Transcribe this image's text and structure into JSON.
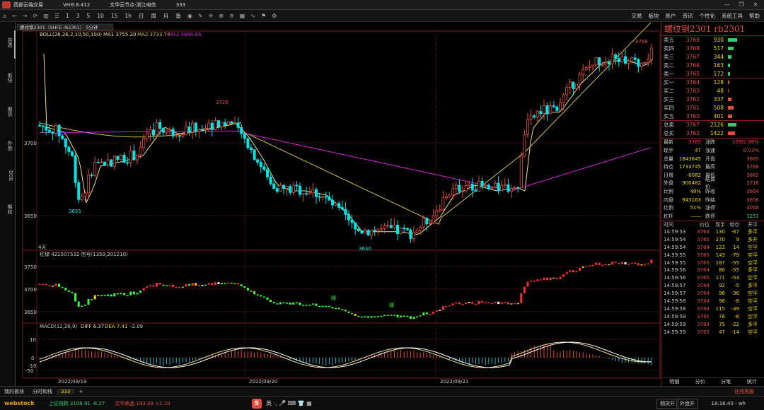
{
  "titlebar": {
    "app_name": "西部云端交易",
    "version": "Ver6.8.412",
    "news": "文华云节点-浙江电信",
    "port": "333",
    "buttons": [
      "—",
      "❐",
      "✕"
    ]
  },
  "toolbar": {
    "periods": [
      "1",
      "3",
      "5",
      "10",
      "15",
      "1h",
      "日",
      "周",
      "月",
      "备"
    ],
    "right_menu": [
      "交易",
      "板块",
      "账户",
      "资讯",
      "个性化",
      "系统工具",
      "帮助"
    ]
  },
  "left_tabs": [
    "自选",
    "板块",
    "期货",
    "外盘",
    "DDE",
    "期权"
  ],
  "chart": {
    "symbol_tag": "螺纹钢2301（SHFE rb2301） 5分钟",
    "boll_label": "BOLL(26,26,2,10,50,100)",
    "ma1": "MA1 3755.20",
    "ma2": "MA2 3733.74",
    "ma3": "MA3 3696.66",
    "main_yaxis": [
      "3700",
      "3650"
    ],
    "annotations": {
      "high_right": "3768",
      "left_high": "3726",
      "left_low": "3655",
      "mid_low": "3630"
    },
    "sub_label": "4天",
    "signal_label": "红绿 421507532 信号(1359,201210)",
    "signal_yaxis": [
      "3750",
      "3700",
      "3650"
    ],
    "signal_marks": [
      "绿",
      "绿"
    ],
    "macd_label": "MACD(12,26,9)",
    "diff": "DIFF 6.37",
    "dea": "DEA 7.41",
    "macd_val": "-2.09",
    "macd_yaxis": [
      "10",
      "0",
      "-10",
      "-50"
    ],
    "dates": [
      "2022/09/19",
      "2022/09/20",
      "2022/09/21"
    ]
  },
  "quote": {
    "name": "螺纹钢2301 rb2301",
    "asks": [
      {
        "label": "卖五",
        "price": "3769",
        "vol": "930",
        "bar": 0.95
      },
      {
        "label": "卖四",
        "price": "3768",
        "vol": "517",
        "bar": 0.55
      },
      {
        "label": "卖三",
        "price": "3767",
        "vol": "344",
        "bar": 0.38
      },
      {
        "label": "卖二",
        "price": "3766",
        "vol": "163",
        "bar": 0.2
      },
      {
        "label": "卖一",
        "price": "3765",
        "vol": "172",
        "bar": 0.2
      }
    ],
    "bids": [
      {
        "label": "买一",
        "price": "3764",
        "vol": "128",
        "bar": 0.15
      },
      {
        "label": "买二",
        "price": "3763",
        "vol": "48",
        "bar": 0.06
      },
      {
        "label": "买三",
        "price": "3762",
        "vol": "337",
        "bar": 0.38
      },
      {
        "label": "买四",
        "price": "3761",
        "vol": "508",
        "bar": 0.55
      },
      {
        "label": "买五",
        "price": "3760",
        "vol": "401",
        "bar": 0.45
      }
    ],
    "total_sell": {
      "label": "总卖",
      "price": "3767",
      "vol": "2126"
    },
    "total_buy": {
      "label": "总买",
      "price": "3762",
      "vol": "1422"
    },
    "stats": [
      {
        "k": "最新",
        "v": "3765",
        "k2": "涨跌",
        "v2": "109/2.98%"
      },
      {
        "k": "现手",
        "v": "47",
        "k2": "涨速",
        "v2": "0.03%"
      },
      {
        "k": "总量",
        "v": "1843645",
        "k2": "开盘",
        "v2": "3665"
      },
      {
        "k": "持仓",
        "v": "1733745",
        "k2": "最高",
        "v2": "3768"
      },
      {
        "k": "日增",
        "v": "-6082",
        "k2": "最低",
        "v2": "3662"
      },
      {
        "k": "外盘",
        "v": "900482",
        "k2": "结算价",
        "v2": "3718"
      },
      {
        "k": "比例",
        "v": "49%",
        "k2": "昨收",
        "v2": "3664"
      },
      {
        "k": "内盘",
        "v": "943163",
        "k2": "昨结",
        "v2": "3656"
      },
      {
        "k": "比例",
        "v": "51%",
        "k2": "涨停",
        "v2": "4058"
      },
      {
        "k": "杠杆",
        "v": "——",
        "k2": "跌停",
        "v2": "3251"
      }
    ],
    "tick_headers": [
      "时间",
      "价位",
      "现手",
      "增仓",
      "开平"
    ],
    "ticks": [
      {
        "t": "14:59:53",
        "p": "3764",
        "v": "130",
        "c": "-67",
        "n": "多平"
      },
      {
        "t": "14:59:54",
        "p": "3765",
        "v": "270",
        "c": "9",
        "n": "多开"
      },
      {
        "t": "14:59:54",
        "p": "3764",
        "v": "123",
        "c": "14",
        "n": "空平"
      },
      {
        "t": "14:59:55",
        "p": "3765",
        "v": "143",
        "c": "-79",
        "n": "空平"
      },
      {
        "t": "14:59:55",
        "p": "3765",
        "v": "187",
        "c": "-55",
        "n": "空平"
      },
      {
        "t": "14:59:56",
        "p": "3764",
        "v": "80",
        "c": "-55",
        "n": "多平"
      },
      {
        "t": "14:59:56",
        "p": "3765",
        "v": "171",
        "c": "-53",
        "n": "空平"
      },
      {
        "t": "14:59:57",
        "p": "3764",
        "v": "92",
        "c": "-5",
        "n": "多平"
      },
      {
        "t": "14:59:57",
        "p": "3764",
        "v": "96",
        "c": "-36",
        "n": "空平"
      },
      {
        "t": "14:59:58",
        "p": "3764",
        "v": "98",
        "c": "-8",
        "n": "空平"
      },
      {
        "t": "14:59:58",
        "p": "3764",
        "v": "115",
        "c": "-49",
        "n": "空平"
      },
      {
        "t": "14:59:59",
        "p": "3765",
        "v": "76",
        "c": "-6",
        "n": "空平"
      },
      {
        "t": "14:59:59",
        "p": "3764",
        "v": "75",
        "c": "-22",
        "n": "多平"
      },
      {
        "t": "14:59:59",
        "p": "3765",
        "v": "47",
        "c": "-14",
        "n": "空平"
      }
    ],
    "bottom_tabs": [
      "明细",
      "分价",
      "分笔",
      "统计"
    ]
  },
  "bottom_tabs": {
    "tabs": [
      "我的板块",
      "分时和线",
      "333",
      "+"
    ],
    "live": "在线客服"
  },
  "status": {
    "brand": "webstock",
    "index1": "上证指数 3108.91 -8.27",
    "index2": "文华商品 193.39 +2.10",
    "ime_s": "S",
    "ime": "英 ·, 🎤 ⌨ 👕 ▦",
    "btn1": "期货开",
    "btn2": "外盘开",
    "time": "18:16:40 - wh"
  },
  "colors": {
    "up": "#e84c3d",
    "down": "#00e5e5",
    "ma1": "#f1e08a",
    "ma2": "#cfc040",
    "ma3": "#d61fd6",
    "signal_green": "#33ff33",
    "signal_red": "#ff2a2a"
  }
}
